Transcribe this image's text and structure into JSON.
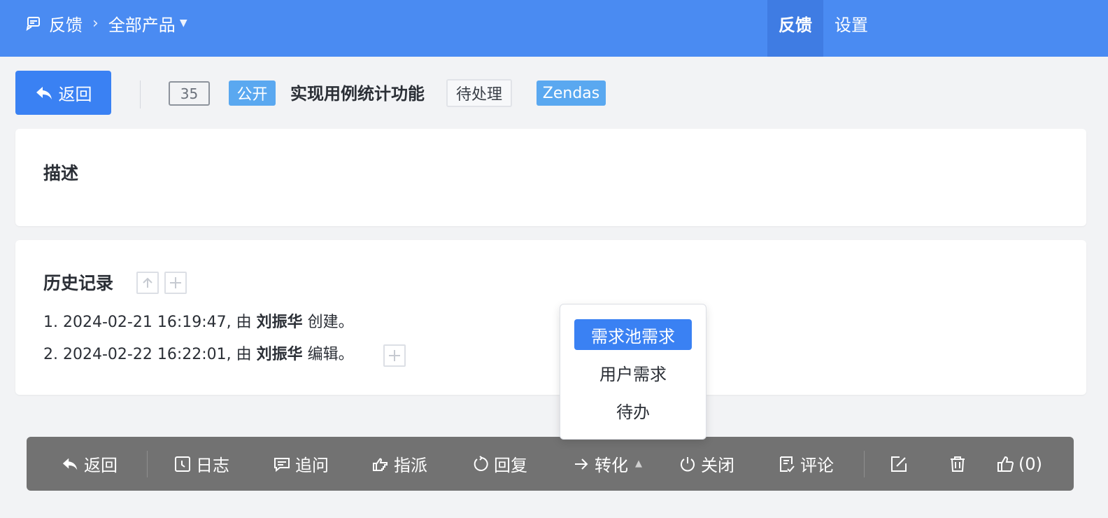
{
  "topbar": {
    "home_label": "反馈",
    "product_label": "全部产品",
    "nav": [
      {
        "label": "反馈",
        "active": true
      },
      {
        "label": "设置",
        "active": false
      }
    ],
    "color": "#4a8bf2"
  },
  "header": {
    "back_label": "返回",
    "id": "35",
    "visibility": "公开",
    "title": "实现用例统计功能",
    "status": "待处理",
    "product": "Zendas"
  },
  "description": {
    "heading": "描述"
  },
  "history": {
    "heading": "历史记录",
    "entries": [
      {
        "prefix": "1. 2024-02-21 16:19:47, 由 ",
        "user": "刘振华",
        "action": " 创建。"
      },
      {
        "prefix": "2. 2024-02-22 16:22:01, 由 ",
        "user": "刘振华",
        "action": " 编辑。"
      }
    ]
  },
  "convert_menu": {
    "items": [
      "需求池需求",
      "用户需求",
      "待办"
    ],
    "selected": "需求池需求"
  },
  "toolbar": {
    "back": "返回",
    "log": "日志",
    "ask": "追问",
    "assign": "指派",
    "reply": "回复",
    "convert": "转化",
    "close": "关闭",
    "comment": "评论",
    "like": "(0)"
  }
}
